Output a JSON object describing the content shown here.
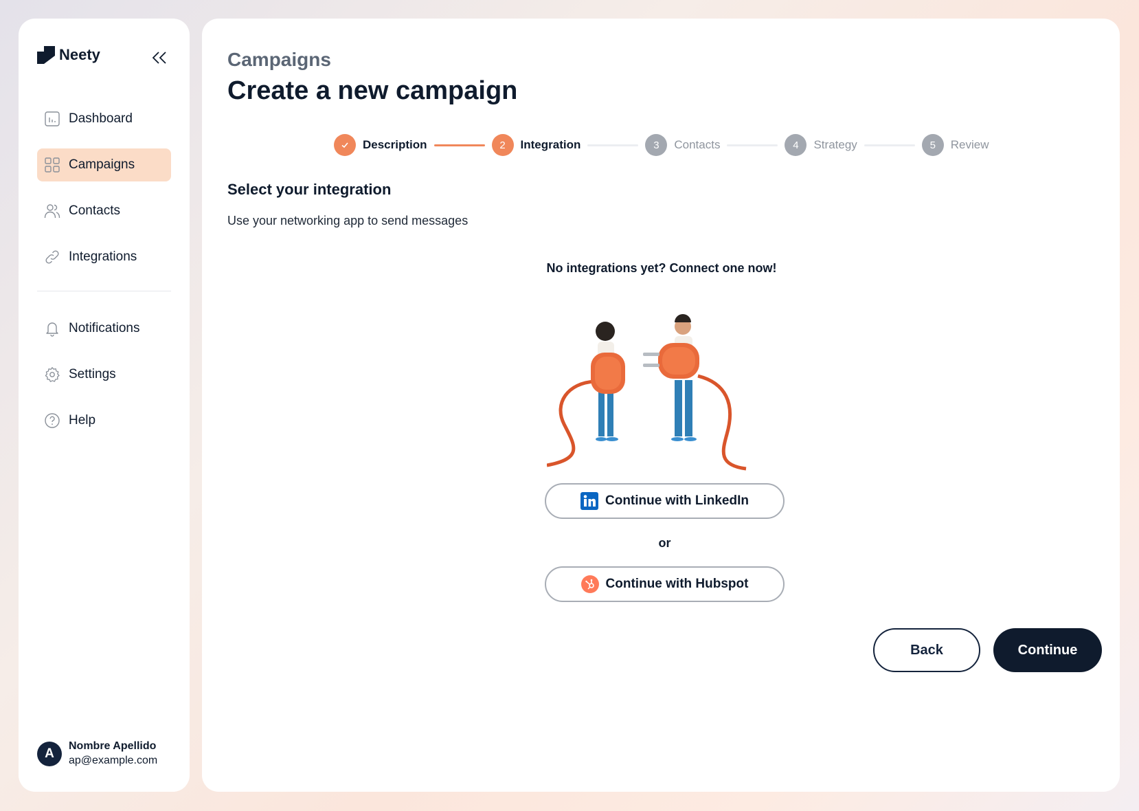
{
  "app": {
    "name": "Neety"
  },
  "sidebar": {
    "items": [
      {
        "label": "Dashboard",
        "icon": "chart-icon",
        "active": false
      },
      {
        "label": "Campaigns",
        "icon": "grid-icon",
        "active": true
      },
      {
        "label": "Contacts",
        "icon": "users-icon",
        "active": false
      },
      {
        "label": "Integrations",
        "icon": "link-icon",
        "active": false
      }
    ],
    "secondary": [
      {
        "label": "Notifications",
        "icon": "bell-icon"
      },
      {
        "label": "Settings",
        "icon": "gear-icon"
      },
      {
        "label": "Help",
        "icon": "help-circle-icon"
      }
    ],
    "user": {
      "initial": "A",
      "name": "Nombre Apellido",
      "email": "ap@example.com"
    }
  },
  "header": {
    "breadcrumb": "Campaigns",
    "title": "Create a new campaign"
  },
  "stepper": {
    "steps": [
      {
        "number": "1",
        "label": "Description",
        "state": "done"
      },
      {
        "number": "2",
        "label": "Integration",
        "state": "current"
      },
      {
        "number": "3",
        "label": "Contacts",
        "state": "pending"
      },
      {
        "number": "4",
        "label": "Strategy",
        "state": "pending"
      },
      {
        "number": "5",
        "label": "Review",
        "state": "pending"
      }
    ]
  },
  "section": {
    "title": "Select your integration",
    "subtitle": "Use your networking app to send messages"
  },
  "empty_state": {
    "title": "No integrations yet? Connect one now!"
  },
  "integrations": {
    "linkedin_label": "Continue with LinkedIn",
    "or_label": "or",
    "hubspot_label": "Continue with Hubspot"
  },
  "actions": {
    "back_label": "Back",
    "continue_label": "Continue"
  },
  "colors": {
    "accent": "#f0875a",
    "navy": "#0f1b2d",
    "active_nav_bg": "#fbdcc7",
    "linkedin": "#0a66c2",
    "hubspot": "#ff7a59"
  }
}
